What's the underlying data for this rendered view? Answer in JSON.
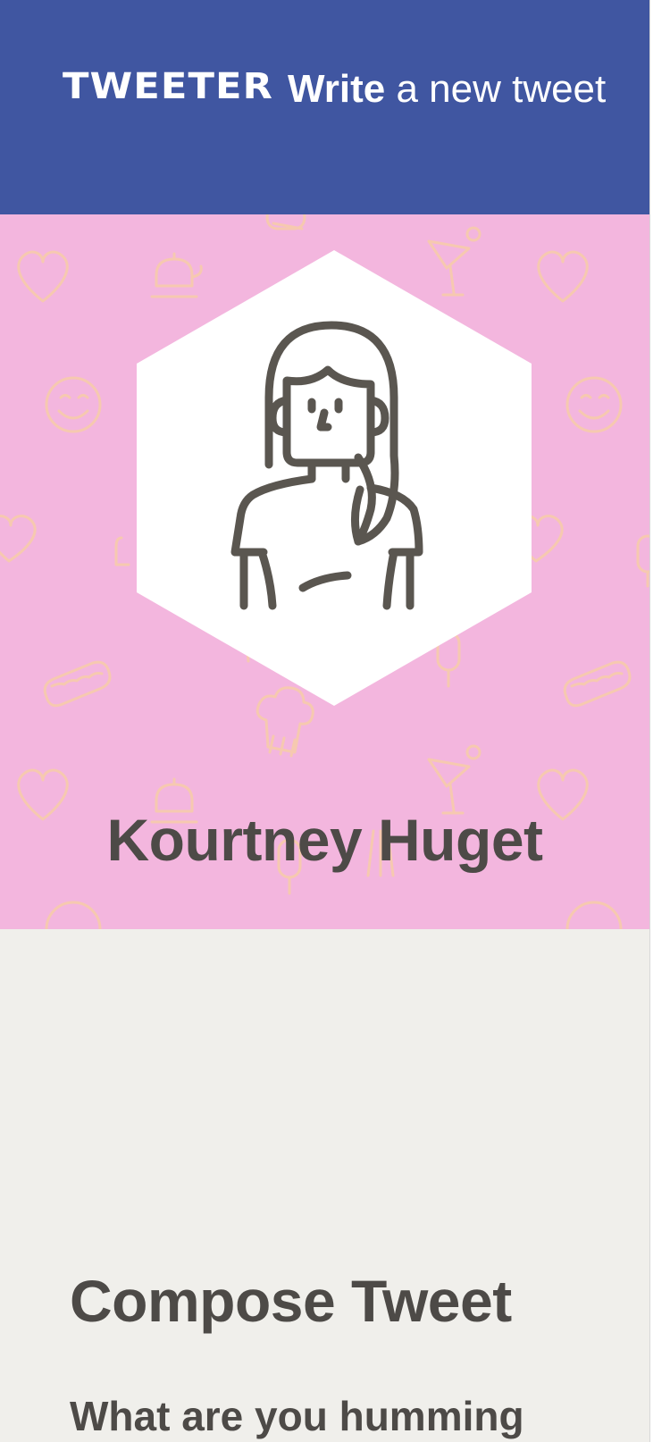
{
  "header": {
    "brand": "TWEETER",
    "cta_strong": "Write",
    "cta_light": "a new tweet"
  },
  "profile": {
    "name": "Kourtney Huget",
    "avatar_icon": "woman-avatar-icon"
  },
  "compose": {
    "title": "Compose Tweet",
    "prompt": "What are you humming"
  },
  "colors": {
    "header_bg": "#4056a1",
    "profile_bg": "#f3b6de",
    "pattern": "#f6c9b0",
    "page_bg": "#f0efeb",
    "text_dark": "#4d4a47"
  }
}
